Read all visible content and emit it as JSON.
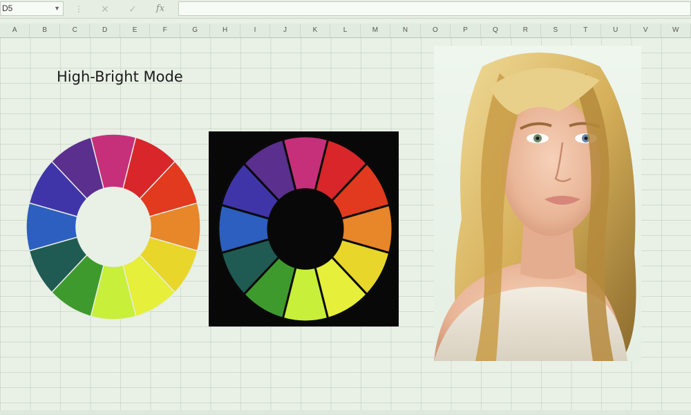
{
  "formula_bar": {
    "name_box": "D5",
    "fx_label": "fx",
    "cancel_symbol": "✕",
    "enter_symbol": "✓",
    "separator": "⋮"
  },
  "columns": [
    "A",
    "B",
    "C",
    "D",
    "E",
    "F",
    "G",
    "H",
    "I",
    "J",
    "K",
    "L",
    "M",
    "N",
    "O",
    "P",
    "Q",
    "R",
    "S",
    "T",
    "U",
    "V",
    "W"
  ],
  "sheet": {
    "title": "High-Bright Mode"
  },
  "colors": {
    "background": "#e9f1e6",
    "wheel_segments": [
      "#c6307a",
      "#d8262b",
      "#e23a1e",
      "#e8862a",
      "#e8d62a",
      "#e6ef3a",
      "#c8ef3a",
      "#3f9a2e",
      "#1f5b52",
      "#2c5fbf",
      "#4035a8",
      "#5a2f8e"
    ],
    "dark_panel": "#080808"
  },
  "icons": {
    "dropdown": "chevron-down-icon",
    "cancel": "close-icon",
    "enter": "check-icon",
    "function": "function-icon"
  }
}
